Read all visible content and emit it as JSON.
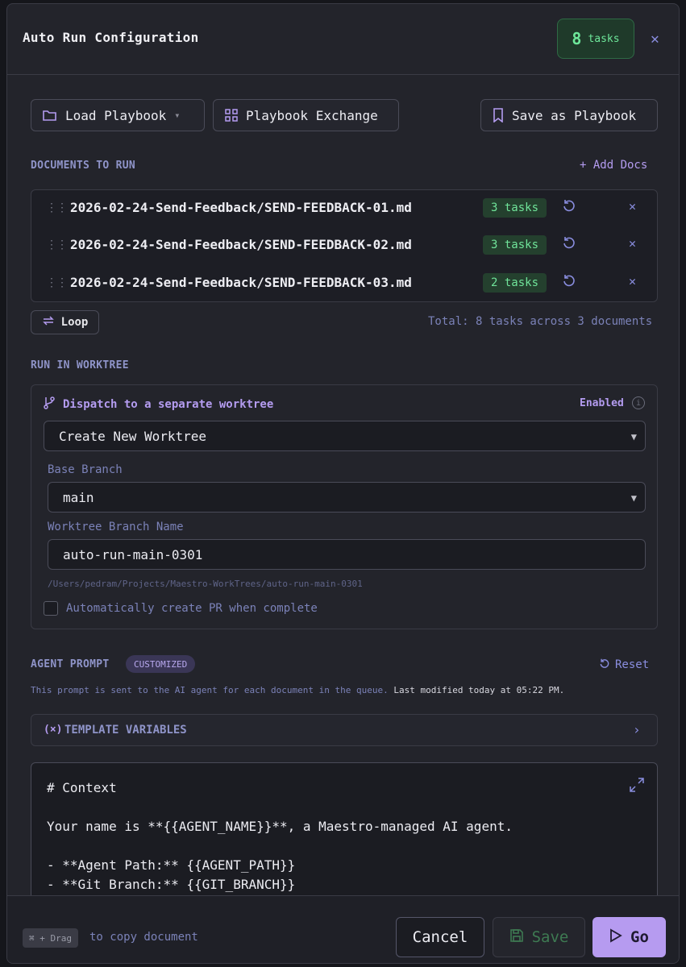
{
  "header": {
    "title": "Auto Run Configuration",
    "task_count": "8",
    "task_label": "tasks",
    "close_icon": "close-icon"
  },
  "toolbar": {
    "load_playbook": "Load Playbook",
    "playbook_exchange": "Playbook Exchange",
    "save_as_playbook": "Save as Playbook"
  },
  "documents": {
    "label": "DOCUMENTS TO RUN",
    "add_docs": "+ Add Docs",
    "items": [
      {
        "name": "2026-02-24-Send-Feedback/SEND-FEEDBACK-01.md",
        "tasks": "3 tasks"
      },
      {
        "name": "2026-02-24-Send-Feedback/SEND-FEEDBACK-02.md",
        "tasks": "3 tasks"
      },
      {
        "name": "2026-02-24-Send-Feedback/SEND-FEEDBACK-03.md",
        "tasks": "2 tasks"
      }
    ],
    "loop": "Loop",
    "total": "Total: 8 tasks across 3 documents"
  },
  "worktree": {
    "label": "RUN IN WORKTREE",
    "dispatch": "Dispatch to a separate worktree",
    "enabled": "Enabled",
    "mode": "Create New Worktree",
    "base_branch_label": "Base Branch",
    "base_branch": "main",
    "branch_name_label": "Worktree Branch Name",
    "branch_name": "auto-run-main-0301",
    "path": "/Users/pedram/Projects/Maestro-WorkTrees/auto-run-main-0301",
    "auto_pr": "Automatically create PR when complete"
  },
  "prompt": {
    "label": "AGENT PROMPT",
    "badge": "CUSTOMIZED",
    "reset": "Reset",
    "description": "This prompt is sent to the AI agent for each document in the queue.",
    "modified": "Last modified today at 05:22 PM.",
    "template_vars": "TEMPLATE VARIABLES",
    "lines": [
      "# Context",
      "Your name is **{{AGENT_NAME}}**, a Maestro-managed AI agent.",
      "- **Agent Path:** {{AGENT_PATH}}",
      "- **Git Branch:** {{GIT_BRANCH}}"
    ]
  },
  "footer": {
    "kbd": "⌘ + Drag",
    "hint": "to copy document",
    "cancel": "Cancel",
    "save": "Save",
    "go": "Go"
  },
  "colors": {
    "accent": "#b69bf0",
    "success": "#6ee79a",
    "muted": "#7b82b8"
  }
}
